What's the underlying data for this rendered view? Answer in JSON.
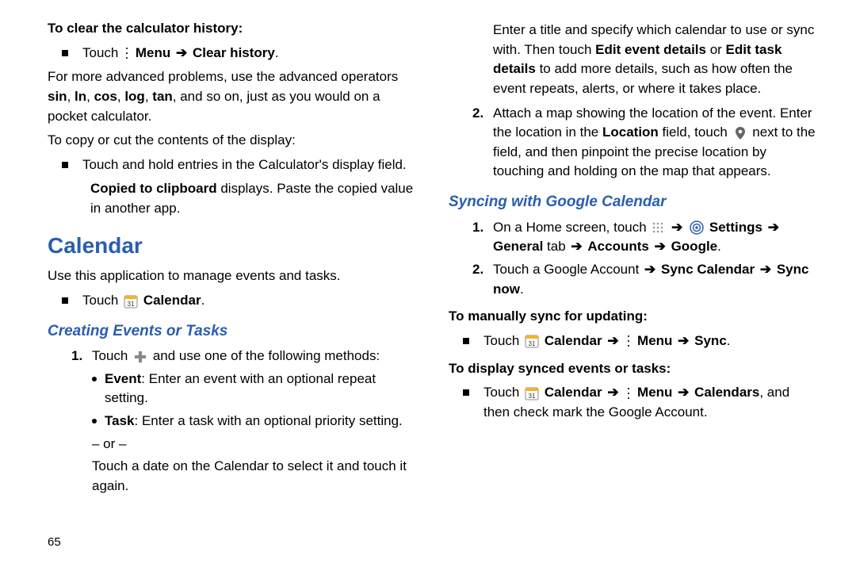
{
  "left": {
    "clear_head": "To clear the calculator history:",
    "touch_menu": "Touch ",
    "menu_label": "Menu",
    "clear_history": "Clear history",
    "advanced1": "For more advanced problems, use the advanced operators ",
    "ops": "sin, ln, cos, log, tan",
    "advanced2": ", and so on, just as you would on a pocket calculator.",
    "copy_head": "To copy or cut the contents of the display:",
    "copy_item": "Touch and hold entries in the Calculator's display field.",
    "copied_bold": "Copied to clipboard",
    "copied_rest": " displays. Paste the copied value in another app.",
    "calendar_h1": "Calendar",
    "calendar_desc": "Use this application to manage events and tasks.",
    "touch_cal_pre": "Touch ",
    "calendar_label": "Calendar",
    "creating_h2": "Creating Events or Tasks",
    "step1a": "Touch ",
    "step1b": " and use one of the following methods:",
    "event_bold": "Event",
    "event_rest": ": Enter an event with an optional repeat setting.",
    "task_bold": "Task",
    "task_rest": ": Enter a task with an optional priority setting.",
    "or": "– or –",
    "touch_date": "Touch a date on the Calendar to select it and touch it again."
  },
  "right": {
    "title_para1": "Enter a title and specify which calendar to use or sync with. Then touch ",
    "edit_event": "Edit event details",
    "or_word": " or ",
    "edit_task": "Edit task details",
    "title_para2": " to add more details, such as how often the event repeats, alerts, or where it takes place.",
    "step2a": "Attach a map showing the location of the event. Enter the location in the ",
    "location_bold": "Location",
    "step2b": " field, touch ",
    "step2c": " next to the field, and then pinpoint the precise location by touching and holding on the map that appears.",
    "sync_h2": "Syncing with Google Calendar",
    "s1a": "On a Home screen, touch ",
    "settings": "Settings",
    "general_tab": "General",
    "tab_word": " tab ",
    "accounts": "Accounts",
    "google": "Google",
    "s2a": "Touch a Google Account ",
    "sync_calendar": "Sync Calendar",
    "sync_now": "Sync now",
    "manual_head": "To manually sync for updating:",
    "m_touch": "Touch ",
    "menu": "Menu",
    "sync": "Sync",
    "display_head": "To display synced events or tasks:",
    "calendars": "Calendars",
    "display_rest": ", and then check mark the Google Account."
  },
  "page_number": "65"
}
